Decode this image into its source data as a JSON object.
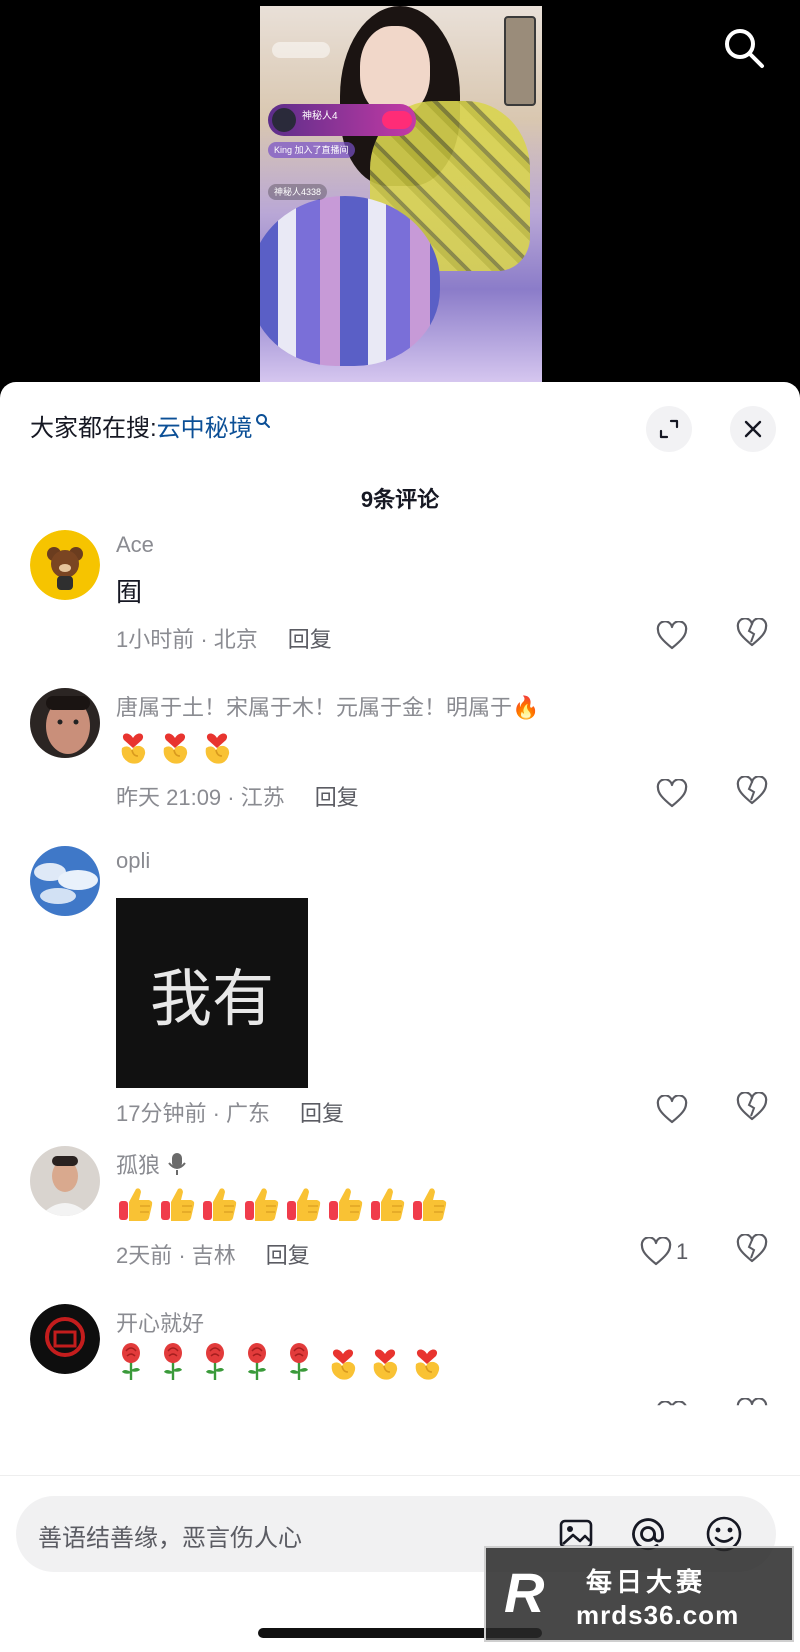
{
  "video": {
    "host_name": "神秘人4",
    "overlay_join_text": "King 加入了直播间",
    "overlay_user_text": "神秘人4338"
  },
  "header": {
    "hot_search_label": "大家都在搜:",
    "hot_search_keyword": "云中秘境",
    "comment_count": "9条评论"
  },
  "comments": [
    {
      "name": "Ace",
      "text": "囿",
      "meta": "1小时前 · 北京",
      "reply": "回复",
      "likes": ""
    },
    {
      "name": "唐属于土！宋属于木！元属于金！明属于🔥",
      "emojis": [
        "finger-heart",
        "finger-heart",
        "finger-heart"
      ],
      "meta": "昨天 21:09 · 江苏",
      "reply": "回复",
      "likes": ""
    },
    {
      "name": "opli",
      "image_text": "我有",
      "meta": "17分钟前 · 广东",
      "reply": "回复",
      "likes": ""
    },
    {
      "name": "孤狼",
      "emojis": [
        "thumbs-up",
        "thumbs-up",
        "thumbs-up",
        "thumbs-up",
        "thumbs-up",
        "thumbs-up",
        "thumbs-up",
        "thumbs-up"
      ],
      "meta": "2天前 · 吉林",
      "reply": "回复",
      "likes": "1"
    },
    {
      "name": "开心就好",
      "emojis": [
        "rose",
        "rose",
        "rose",
        "rose",
        "rose",
        "finger-heart",
        "finger-heart",
        "finger-heart"
      ]
    }
  ],
  "input": {
    "placeholder": "善语结善缘，恶言伤人心"
  },
  "watermark": {
    "logo": "R",
    "title": "每日大赛",
    "url": "mrds36.com"
  },
  "colors": {
    "keyword": "#0b4f96",
    "meta_gray": "#8a8b91",
    "text": "#161823"
  }
}
